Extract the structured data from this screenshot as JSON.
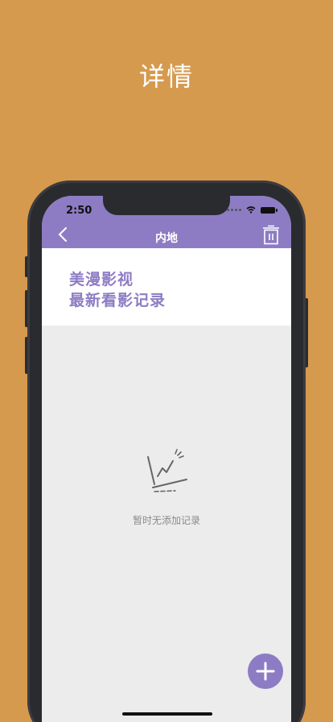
{
  "promo": {
    "title": "详情"
  },
  "status_bar": {
    "time": "2:50"
  },
  "nav": {
    "title": "内地",
    "back_icon": "chevron-left-icon",
    "trash_icon": "trash-icon"
  },
  "header": {
    "line1": "美漫影视",
    "line2": "最新看影记录"
  },
  "empty_state": {
    "message": "暂时无添加记录",
    "icon": "chart-line-icon"
  },
  "fab": {
    "icon": "plus-icon"
  },
  "colors": {
    "background": "#d69a4e",
    "accent": "#8d7cc4",
    "screen_bg": "#ececec"
  }
}
